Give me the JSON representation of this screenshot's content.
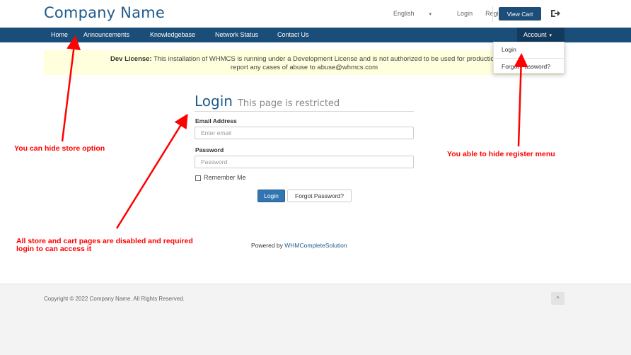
{
  "header": {
    "brand": "Company Name",
    "language": "English",
    "login": "Login",
    "register": "Register",
    "view_cart": "View Cart",
    "logout_icon": "logout-icon"
  },
  "nav": {
    "items": [
      "Home",
      "Announcements",
      "Knowledgebase",
      "Network Status",
      "Contact Us"
    ],
    "account": "Account"
  },
  "dropdown": {
    "items": [
      "Login",
      "Forgot Password?"
    ]
  },
  "banner": {
    "label": "Dev License:",
    "text": " This installation of WHMCS is running under a Development License and is not authorized to be used for production",
    "line2": "report any cases of abuse to abuse@whmcs.com"
  },
  "login": {
    "title": "Login",
    "subtitle": "This page is restricted",
    "email_label": "Email Address",
    "email_placeholder": "Enter email",
    "password_label": "Password",
    "password_placeholder": "Password",
    "remember": "Remember Me",
    "login_button": "Login",
    "forgot_button": "Forgot Password?"
  },
  "powered": {
    "prefix": "Powered by ",
    "link": "WHMCompleteSolution"
  },
  "footer": {
    "copyright": "Copyright © 2022 Company Name. All Rights Reserved.",
    "back_to_top": "^"
  },
  "annotations": {
    "store": "You can hide store option",
    "register": "You able to hide register menu",
    "cart_line1": "All store and cart pages are disabled and required",
    "cart_line2": "login to can access it"
  },
  "colors": {
    "brand": "#1f5a8a",
    "navbar": "#1b4d79",
    "annotation": "#ff0000",
    "banner": "#ffffdd"
  }
}
